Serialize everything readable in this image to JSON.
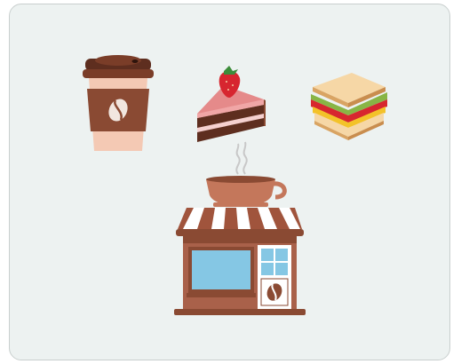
{
  "illustration": {
    "items": [
      "coffee-cup-icon",
      "cake-slice-icon",
      "sandwich-icon",
      "coffee-shop-icon"
    ],
    "colors": {
      "background": "#edf2f1",
      "border": "#c9cfce",
      "brown": "#8a4a33",
      "dark_brown": "#5e2e1f",
      "cream": "#f4c9b4",
      "cake_pink": "#e58a8a",
      "strawberry": "#d7262f",
      "window_blue": "#85c7e4",
      "awning_stripe": "#ffffff"
    }
  }
}
